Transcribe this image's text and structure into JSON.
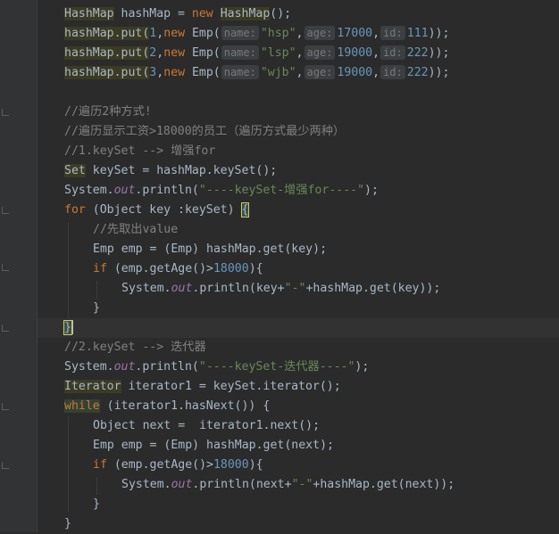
{
  "code": {
    "top_fragment": ";",
    "l1": {
      "type": "HashMap",
      "decl": " hashMap = ",
      "new": "new",
      "type2": "HashMap",
      "tail": "();"
    },
    "put1": {
      "a": "hashMap.put(",
      "n": "1",
      "c": ",",
      "kw": "new",
      "b": " Emp(",
      "hint_name": "name:",
      "name": "\"hsp\"",
      "comma": ",",
      "hint_age": "age:",
      "age": "17000",
      "comma2": ",",
      "hint_id": "id:",
      "id": "111",
      "tail": "));"
    },
    "put2": {
      "a": "hashMap.put(",
      "n": "2",
      "c": ",",
      "kw": "new",
      "b": " Emp(",
      "hint_name": "name:",
      "name": "\"lsp\"",
      "comma": ",",
      "hint_age": "age:",
      "age": "19000",
      "comma2": ",",
      "hint_id": "id:",
      "id": "222",
      "tail": "));"
    },
    "put3": {
      "a": "hashMap.put(",
      "n": "3",
      "c": ",",
      "kw": "new",
      "b": " Emp(",
      "hint_name": "name:",
      "name": "\"wjb\"",
      "comma": ",",
      "hint_age": "age:",
      "age": "19000",
      "comma2": ",",
      "hint_id": "id:",
      "id": "222",
      "tail": "));"
    },
    "c1": "//遍历2种方式!",
    "c2": "//遍历显示工资>18000的员工（遍历方式最少两种）",
    "c3": "//1.keySet --> 增强for",
    "l_set": {
      "type": "Set",
      "rest": " keySet = hashMap.keySet();"
    },
    "l_print1": {
      "a": "System.",
      "out": "out",
      "b": ".println(",
      "s": "\"----keySet-增强for----\"",
      "t": ");"
    },
    "l_for": {
      "kw": "for",
      "rest": " (Object key :keySet) ",
      "brace": "{"
    },
    "c4": "//先取出value",
    "l_emp1": "Emp emp = (Emp) hashMap.get(key);",
    "l_if1": {
      "kw": "if",
      "a": " (emp.getAge()>",
      "n": "18000",
      "b": "){"
    },
    "l_print2": {
      "a": "System.",
      "out": "out",
      "b": ".println(key+",
      "s": "\"-\"",
      "t": "+hashMap.get(key));"
    },
    "close_if1": "}",
    "close_for": "}",
    "c5": "//2.keySet --> 迭代器",
    "l_print3": {
      "a": "System.",
      "out": "out",
      "b": ".println(",
      "s": "\"----keySet-迭代器----\"",
      "t": ");"
    },
    "l_iter": {
      "type": "Iterator",
      "rest": " iterator1 = keySet.iterator();"
    },
    "l_while": {
      "kw": "while",
      "rest": " (iterator1.hasNext()) {"
    },
    "l_next": "Object next =  iterator1.next();",
    "l_emp2": "Emp emp = (Emp) hashMap.get(next);",
    "l_if2": {
      "kw": "if",
      "a": " (emp.getAge()>",
      "n": "18000",
      "b": "){"
    },
    "l_print4": {
      "a": "System.",
      "out": "out",
      "b": ".println(next+",
      "s": "\"-\"",
      "t": "+hashMap.get(next));"
    },
    "close_if2": "}",
    "close_while": "}"
  },
  "colors": {
    "background": "#2b2b2b",
    "keyword": "#cc7832",
    "number": "#6897bb",
    "string": "#6a8759",
    "comment": "#808080",
    "field": "#9876aa",
    "text": "#a9b7c6"
  }
}
